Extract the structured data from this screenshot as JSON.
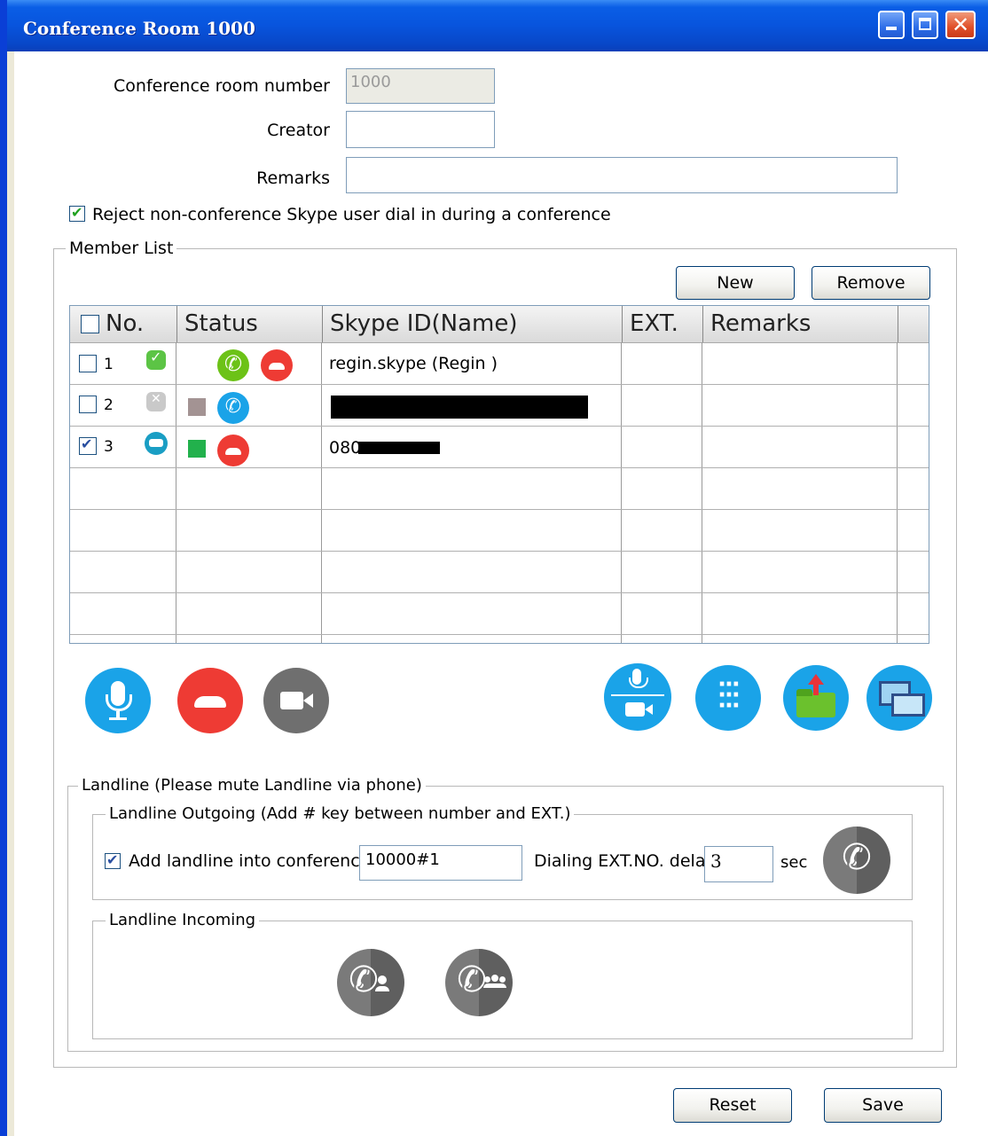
{
  "window": {
    "title": "Conference Room 1000",
    "controls": [
      "minimize",
      "maximize",
      "close"
    ]
  },
  "form": {
    "room_number_label": "Conference room number",
    "room_number_value": "1000",
    "creator_label": "Creator",
    "creator_value": "",
    "remarks_label": "Remarks",
    "remarks_value": "",
    "reject_label": "Reject non-conference Skype user dial in during a conference",
    "reject_checked": true
  },
  "member_list": {
    "legend": "Member List",
    "new_button": "New",
    "remove_button": "Remove",
    "columns": [
      "No.",
      "Status",
      "Skype ID(Name)",
      "EXT.",
      "Remarks"
    ],
    "rows": [
      {
        "no": "1",
        "checked": false,
        "presence": "online",
        "status_icons": [
          "answer-call-icon",
          "hangup-icon"
        ],
        "skype_id": "regin.skype (Regin )",
        "ext": "",
        "remarks": ""
      },
      {
        "no": "2",
        "checked": false,
        "presence": "offline",
        "status_icons": [
          "gray-square",
          "calling-icon"
        ],
        "skype_id": "",
        "ext": "",
        "remarks": ""
      },
      {
        "no": "3",
        "checked": true,
        "presence": "phone",
        "status_icons": [
          "green-square",
          "hangup-icon"
        ],
        "skype_id": "080",
        "ext": "",
        "remarks": ""
      }
    ],
    "empty_rows": 4
  },
  "action_icons": [
    "microphone-icon",
    "hangup-icon",
    "video-camera-icon",
    "mic-video-icon",
    "dialpad-icon",
    "send-file-icon",
    "screen-share-icon"
  ],
  "landline": {
    "legend": "Landline (Please mute Landline via phone)",
    "outgoing_legend": "Landline Outgoing (Add # key between number and EXT.)",
    "add_label": "Add landline into conference",
    "add_checked": true,
    "number_value": "10000#1",
    "delay_label": "Dialing EXT.NO. delay",
    "delay_value": "3",
    "sec_label": "sec",
    "incoming_legend": "Landline Incoming"
  },
  "footer": {
    "reset_button": "Reset",
    "save_button": "Save"
  },
  "colors": {
    "title_bar": "#0854dd",
    "blue_icon": "#1aa3e8",
    "red_icon": "#ee3b34",
    "gray_icon": "#6f6f6f",
    "green_icon": "#6cc217"
  }
}
